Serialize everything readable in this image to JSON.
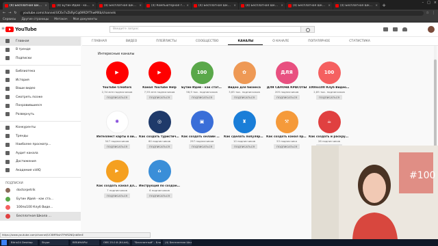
{
  "browser": {
    "tabs": [
      {
        "label": "(9) Бесплатная Школа Видеобл"
      },
      {
        "label": "(4) Бутин Идей - как стать фрил"
      },
      {
        "label": "(4) Бесплатная Школа Видеобл"
      },
      {
        "label": "(4) Компьютерная грамотность"
      },
      {
        "label": "(4) Бесплатная Школа Видеобл"
      },
      {
        "label": "(4) Бесплатная Школа Видеобл"
      },
      {
        "label": "(4) Бесплатная Школа Видеобл"
      },
      {
        "label": "(4) Бесплатная Школа Видеобл"
      }
    ],
    "url": "youtube.com/channel/UC6v7vZkRyiCq69RDYThwMXb/channels",
    "bookmarks": [
      "Сервисы",
      "Другие страницы",
      "Метакач",
      "Моя документы"
    ]
  },
  "youtube": {
    "logo_text": "YouTube",
    "search_placeholder": "Введите запрос"
  },
  "channel_tabs": [
    {
      "label": "ГЛАВНАЯ"
    },
    {
      "label": "ВИДЕО"
    },
    {
      "label": "ПЛЕЙЛИСТЫ"
    },
    {
      "label": "СООБЩЕСТВО"
    },
    {
      "label": "КАНАЛЫ"
    },
    {
      "label": "О КАНАЛЕ"
    },
    {
      "label": "ПОПУЛЯРНОЕ"
    },
    {
      "label": "СТАТИСТИКА"
    }
  ],
  "sidebar": {
    "items": [
      {
        "label": "Главная"
      },
      {
        "label": "В тренде"
      },
      {
        "label": "Подписки"
      },
      {
        "label": "Библиотека"
      },
      {
        "label": "История"
      },
      {
        "label": "Ваши видео"
      },
      {
        "label": "Смотреть позже"
      },
      {
        "label": "Понравившиеся"
      },
      {
        "label": "Развернуть"
      },
      {
        "label": "Конкуренты"
      },
      {
        "label": "Тренды"
      },
      {
        "label": "Наиболее просматр..."
      },
      {
        "label": "Аудит канала"
      },
      {
        "label": "Достижения"
      },
      {
        "label": "Академия vidIQ"
      }
    ],
    "subs_heading": "ПОДПИСКИ",
    "subs": [
      {
        "label": "doctorpetrik"
      },
      {
        "label": "Бутин Идей - как ста..."
      },
      {
        "label": "100по100 Клуб Виде..."
      },
      {
        "label": "Бесплатная Школа ..."
      }
    ]
  },
  "section_title": "Интересные каналы",
  "subscribe_label": "ПОДПИСАТЬСЯ",
  "channels": [
    {
      "name": "YouTube Creators",
      "subs": "2,34 млн подписчиков",
      "color": "#f00",
      "glyph": "▶"
    },
    {
      "name": "Канал YouTube Help",
      "subs": "7,55 млн подписчиков",
      "color": "#f00",
      "glyph": "▶"
    },
    {
      "name": "Бутин Идей - как стать фрила...",
      "subs": "58,9 тыс. подписчиков",
      "color": "#5aa84a",
      "glyph": "100"
    },
    {
      "name": "Видео для бизнеса",
      "subs": "3,65 тыс. подписчиков",
      "color": "#e95",
      "glyph": "✿"
    },
    {
      "name": "ДЛЯ САЛОНА КРАСОТЫ",
      "subs": "205 подписчиков",
      "color": "#e85080",
      "glyph": "ДЛЯ"
    },
    {
      "name": "100по100 Клуб Видеомаркет...",
      "subs": "2,85 тыс. подписчиков",
      "color": "#f56060",
      "glyph": "100"
    },
    {
      "name": "",
      "subs": "",
      "color": "",
      "glyph": ""
    },
    {
      "name": "Интеллект карты в видеомар...",
      "subs": "547 подписчиков",
      "color": "#fff",
      "glyph": "✺"
    },
    {
      "name": "Как создать туристический к...",
      "subs": "60 подписчиков",
      "color": "#1f3a6a",
      "glyph": "◎"
    },
    {
      "name": "Как создать онлайн школу с ...",
      "subs": "297 подписчиков",
      "color": "#3a6ed8",
      "glyph": "▣"
    },
    {
      "name": "Как сделать популярный дет...",
      "subs": "10 подписчиков",
      "color": "#1a7ed8",
      "glyph": "♜"
    },
    {
      "name": "Как создать канал про ремон...",
      "subs": "53 подписчика",
      "color": "#f59a3a",
      "glyph": "⚒"
    },
    {
      "name": "Как создать и раскрутить кул...",
      "subs": "28 подписчиков",
      "color": "#e04040",
      "glyph": "☕"
    },
    {
      "name": "",
      "subs": "",
      "color": "",
      "glyph": ""
    },
    {
      "name": "Как создать канал для масте...",
      "subs": "7 подписчиков",
      "color": "#f5a020",
      "glyph": "▶"
    },
    {
      "name": "Инструкция по созданию вид...",
      "subs": "6 подписчиков",
      "color": "#3a8ed8",
      "glyph": "⌂"
    }
  ],
  "status_url": "https://www.youtube.com/channel/UC6MPAsH7PhRDNQnbBmE",
  "taskbar": [
    "Bitrix24 Desktop",
    "Skype",
    "ВЕБИНАРЫ",
    "OBS 25.0.8 (64-bit), ...",
    "\"Бесплатный\" - Блок...",
    "(4) Бесплатная Шко..."
  ]
}
